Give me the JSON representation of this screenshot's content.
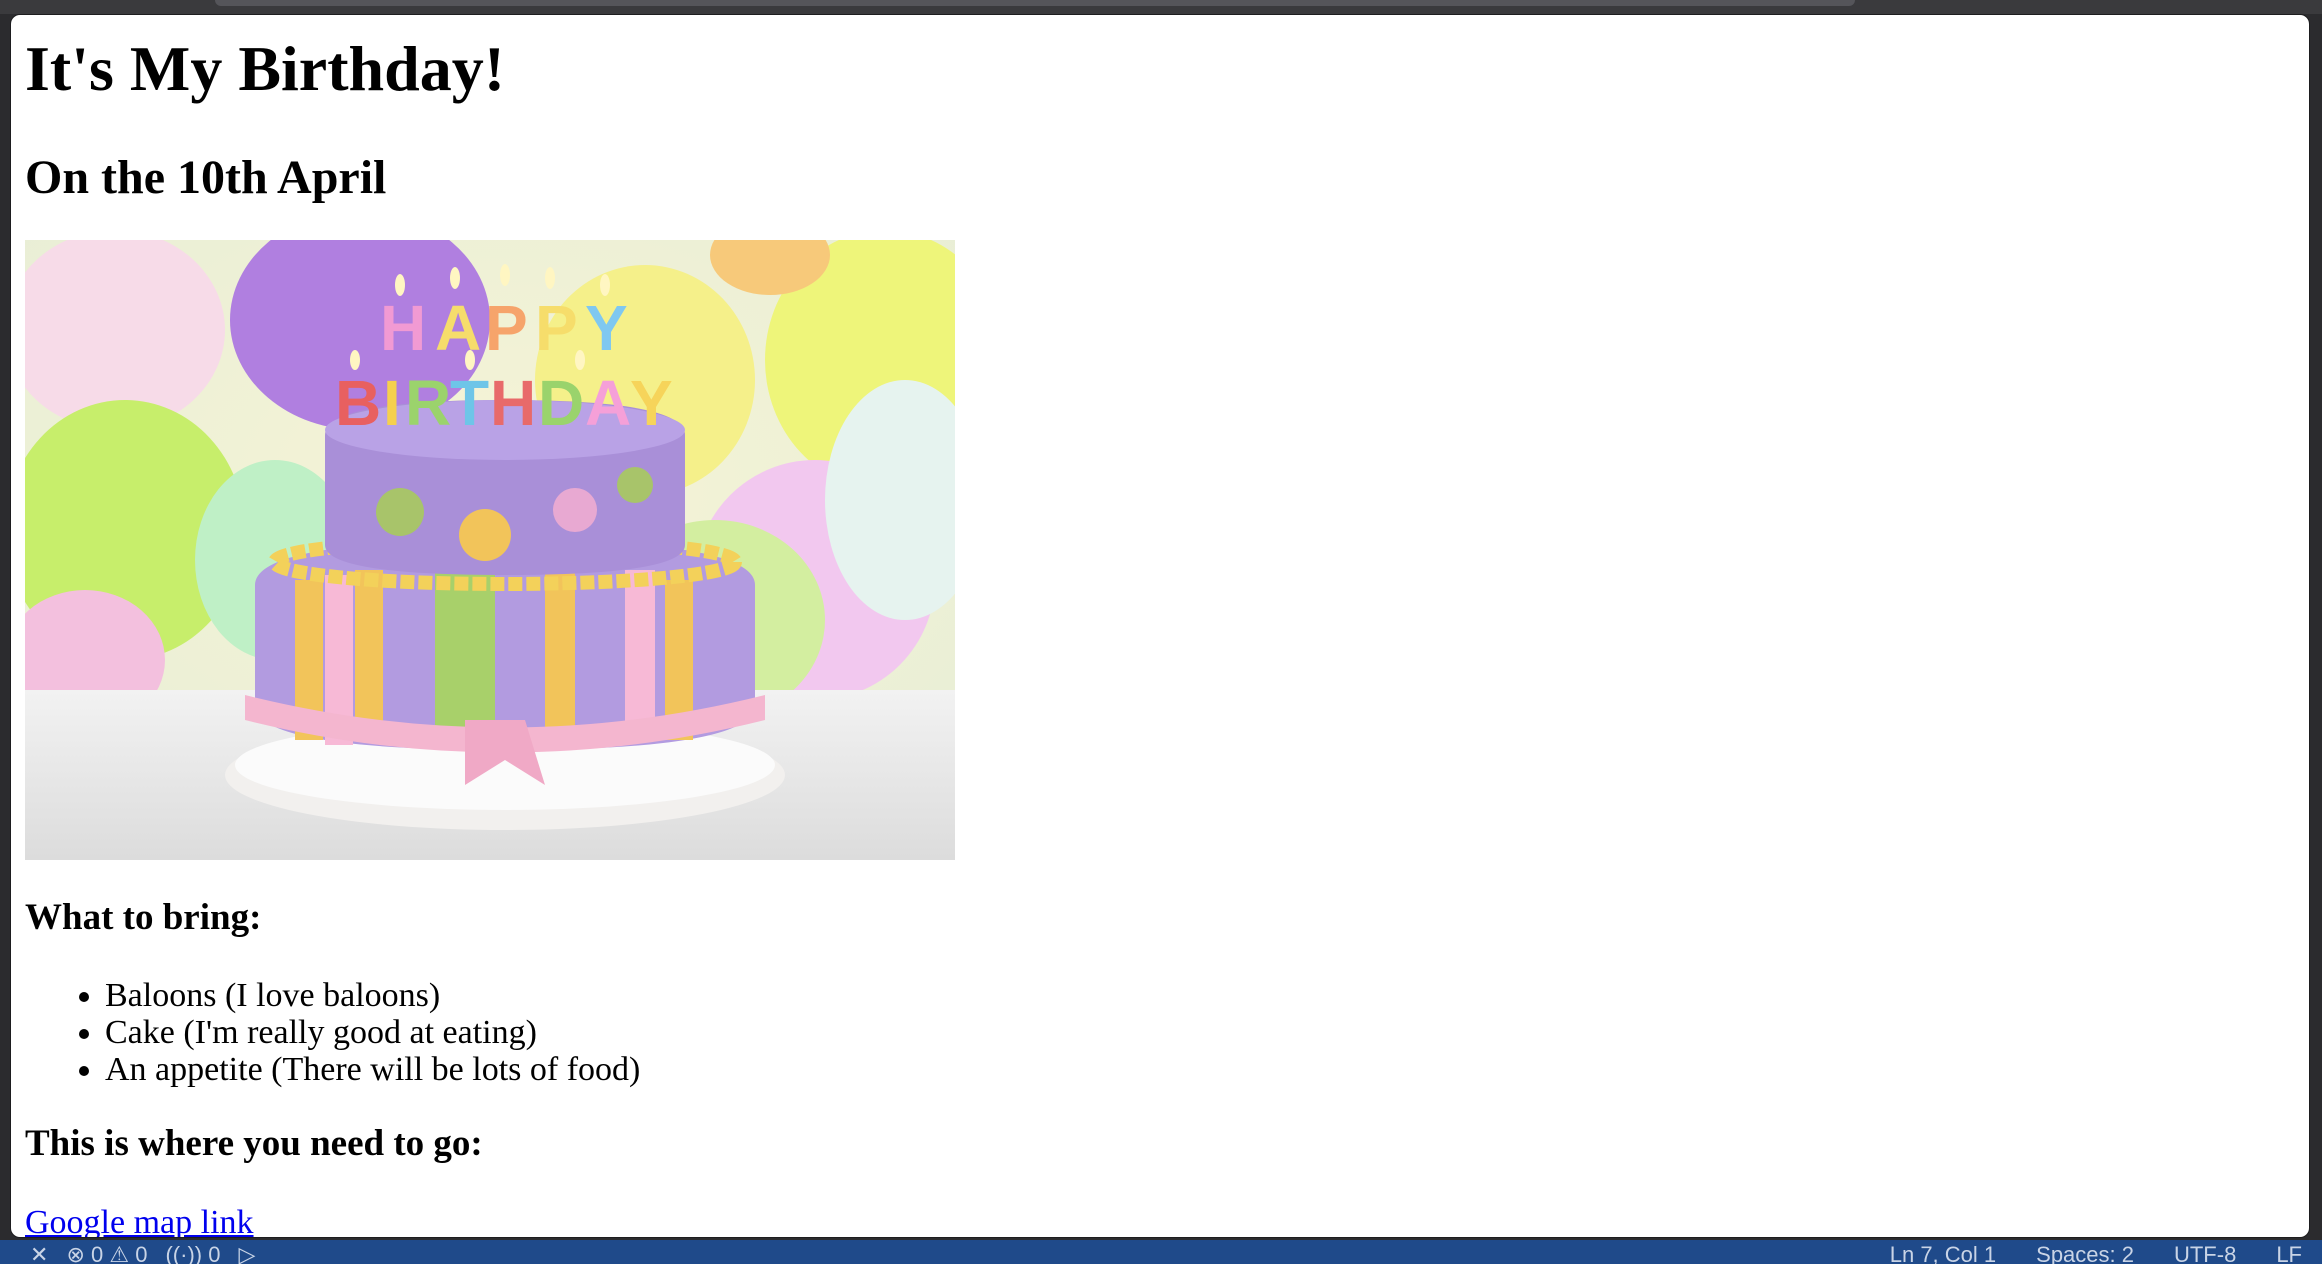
{
  "page": {
    "title": "It's My Birthday!",
    "subtitle": "On the 10th April",
    "bring_heading": "What to bring:",
    "bring_items": [
      "Baloons (I love baloons)",
      "Cake (I'm really good at eating)",
      "An appetite (There will be lots of food)"
    ],
    "where_heading": "This is where you need to go:",
    "map_link": "Google map link"
  },
  "cake_image": {
    "candle_top": [
      "H",
      "A",
      "P",
      "P",
      "Y"
    ],
    "candle_bottom": [
      "B",
      "I",
      "R",
      "T",
      "H",
      "D",
      "A",
      "Y"
    ]
  },
  "status_bar": {
    "errors": "0",
    "warnings": "0",
    "ports": "0",
    "position": "Ln 7, Col 1",
    "spaces": "Spaces: 2",
    "encoding": "UTF-8",
    "eol": "LF"
  }
}
